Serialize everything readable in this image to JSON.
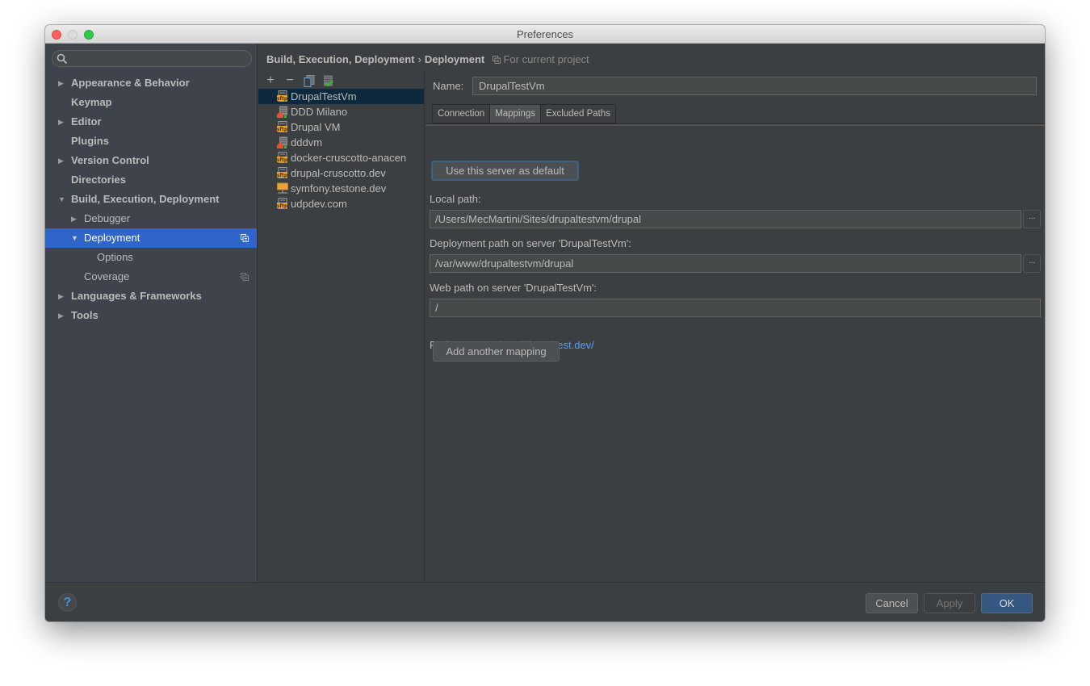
{
  "window": {
    "title": "Preferences"
  },
  "sidebar": {
    "search_placeholder": "",
    "items": [
      {
        "label": "Appearance & Behavior",
        "level": 0,
        "bold": true,
        "arrow": "collapsed"
      },
      {
        "label": "Keymap",
        "level": 0,
        "bold": true,
        "arrow": "none"
      },
      {
        "label": "Editor",
        "level": 0,
        "bold": true,
        "arrow": "collapsed"
      },
      {
        "label": "Plugins",
        "level": 0,
        "bold": true,
        "arrow": "none"
      },
      {
        "label": "Version Control",
        "level": 0,
        "bold": true,
        "arrow": "collapsed"
      },
      {
        "label": "Directories",
        "level": 0,
        "bold": true,
        "arrow": "none"
      },
      {
        "label": "Build, Execution, Deployment",
        "level": 0,
        "bold": true,
        "arrow": "expanded"
      },
      {
        "label": "Debugger",
        "level": 1,
        "bold": false,
        "arrow": "collapsed"
      },
      {
        "label": "Deployment",
        "level": 1,
        "bold": false,
        "arrow": "expanded",
        "selected": true,
        "project_icon": true
      },
      {
        "label": "Options",
        "level": 2,
        "bold": false,
        "arrow": "none"
      },
      {
        "label": "Coverage",
        "level": 1,
        "bold": false,
        "arrow": "none",
        "project_icon": true
      },
      {
        "label": "Languages & Frameworks",
        "level": 0,
        "bold": true,
        "arrow": "collapsed"
      },
      {
        "label": "Tools",
        "level": 0,
        "bold": true,
        "arrow": "collapsed"
      }
    ]
  },
  "breadcrumb": {
    "parent": "Build, Execution, Deployment",
    "separator": "›",
    "current": "Deployment",
    "scope": "For current project"
  },
  "server_toolbar": {
    "add": "+",
    "remove": "−",
    "copy_icon": "copy-icon",
    "default_icon": "use-as-default-icon"
  },
  "servers": [
    {
      "name": "DrupalTestVm",
      "type": "sftp",
      "selected": true
    },
    {
      "name": "DDD Milano",
      "type": "local"
    },
    {
      "name": "Drupal VM",
      "type": "sftp"
    },
    {
      "name": "dddvm",
      "type": "local"
    },
    {
      "name": "docker-cruscotto-anacen",
      "type": "sftp"
    },
    {
      "name": "drupal-cruscotto.dev",
      "type": "sftp"
    },
    {
      "name": "symfony.testone.dev",
      "type": "mounted"
    },
    {
      "name": "udpdev.com",
      "type": "sftp"
    }
  ],
  "details": {
    "name_label": "Name:",
    "name_value": "DrupalTestVm",
    "tabs": [
      {
        "label": "Connection",
        "active": false
      },
      {
        "label": "Mappings",
        "active": true
      },
      {
        "label": "Excluded Paths",
        "active": false
      }
    ],
    "default_button": "Use this server as default",
    "local_path_label": "Local path:",
    "local_path_value": "/Users/MecMartini/Sites/drupaltestvm/drupal",
    "deployment_path_label": "Deployment path on server 'DrupalTestVm':",
    "deployment_path_value": "/var/www/drupaltestvm/drupal",
    "web_path_label": "Web path on server 'DrupalTestVm':",
    "web_path_value": "/",
    "browse_label": "...",
    "project_url_label": "Project URL:",
    "project_url_value": "http://drupaltest.dev/",
    "add_mapping_button": "Add another mapping"
  },
  "footer": {
    "help": "?",
    "cancel": "Cancel",
    "apply": "Apply",
    "ok": "OK"
  },
  "colors": {
    "selection": "#2f65ca",
    "server_selection": "#0d293e",
    "link": "#589df6",
    "primary_button": "#365880"
  }
}
